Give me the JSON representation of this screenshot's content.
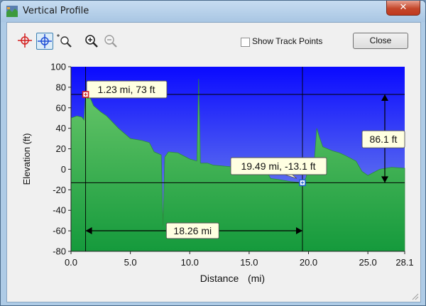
{
  "window": {
    "title": "Vertical Profile",
    "close_glyph": "✕",
    "icon": "app-profile-icon"
  },
  "toolbar": {
    "tools": [
      {
        "icon": "red-crosshair-icon",
        "color": "#d42020"
      },
      {
        "icon": "blue-crosshair-icon",
        "color": "#1f4fd6",
        "active": true
      },
      {
        "icon": "zoom-extent-icon"
      },
      {
        "icon": "zoom-in-icon"
      },
      {
        "icon": "zoom-out-icon",
        "disabled": true
      }
    ],
    "show_track_points_label": "Show Track Points",
    "show_track_points_checked": false,
    "close_label": "Close"
  },
  "colors": {
    "sky_top": "#0a0aff",
    "sky_bottom": "#8aa6e6",
    "terrain_top": "#6cc86c",
    "terrain_bottom": "#159a3c",
    "marker_red": "#d42020",
    "marker_blue": "#2060d0",
    "callout_fill": "#ffffe1"
  },
  "chart_data": {
    "type": "area",
    "xlabel": "Distance",
    "xunit": "(mi)",
    "ylabel": "Elevation (ft)",
    "xlim": [
      0,
      28.1
    ],
    "ylim": [
      -80,
      100
    ],
    "x_ticks": [
      "0.0",
      "5.0",
      "10.0",
      "15.0",
      "20.0",
      "25.0",
      "28.1"
    ],
    "x_tick_values": [
      0,
      5,
      10,
      15,
      20,
      25,
      28.1
    ],
    "y_ticks": [
      "100",
      "80",
      "60",
      "40",
      "20",
      "0",
      "-20",
      "-40",
      "-60",
      "-80"
    ],
    "y_tick_values": [
      100,
      80,
      60,
      40,
      20,
      0,
      -20,
      -40,
      -60,
      -80
    ],
    "profile": [
      [
        0.0,
        50
      ],
      [
        0.5,
        52
      ],
      [
        0.9,
        51
      ],
      [
        1.1,
        48
      ],
      [
        1.23,
        73
      ],
      [
        1.4,
        69
      ],
      [
        1.6,
        70
      ],
      [
        1.9,
        62
      ],
      [
        2.5,
        56
      ],
      [
        3.0,
        52
      ],
      [
        4.0,
        40
      ],
      [
        5.0,
        30
      ],
      [
        6.0,
        28
      ],
      [
        6.6,
        26
      ],
      [
        7.0,
        17
      ],
      [
        7.6,
        14
      ],
      [
        7.75,
        -55
      ],
      [
        7.9,
        12
      ],
      [
        8.2,
        17
      ],
      [
        9.0,
        16
      ],
      [
        10.0,
        10
      ],
      [
        10.6,
        8
      ],
      [
        10.75,
        88
      ],
      [
        10.9,
        6
      ],
      [
        11.5,
        6
      ],
      [
        12.0,
        4
      ],
      [
        13.0,
        3
      ],
      [
        14.0,
        2
      ],
      [
        15.0,
        0
      ],
      [
        16.0,
        -1
      ],
      [
        16.5,
        -2
      ],
      [
        16.8,
        -9
      ],
      [
        17.5,
        -10
      ],
      [
        18.5,
        -12
      ],
      [
        19.49,
        -13.1
      ],
      [
        19.8,
        -8
      ],
      [
        20.0,
        4
      ],
      [
        20.5,
        10
      ],
      [
        20.7,
        40
      ],
      [
        20.9,
        32
      ],
      [
        21.2,
        22
      ],
      [
        22.0,
        18
      ],
      [
        22.6,
        16
      ],
      [
        23.0,
        14
      ],
      [
        24.0,
        8
      ],
      [
        24.5,
        -2
      ],
      [
        25.0,
        -6
      ],
      [
        26.0,
        0
      ],
      [
        27.0,
        2
      ],
      [
        28.1,
        1
      ]
    ],
    "markers": [
      {
        "label": "1.23 mi, 73 ft",
        "x": 1.23,
        "y": 73,
        "color": "red"
      },
      {
        "label": "19.49 mi, -13.1 ft",
        "x": 19.49,
        "y": -13.1,
        "color": "blue"
      }
    ],
    "distance_measure": {
      "label": "18.26 mi",
      "from": 1.23,
      "to": 19.49
    },
    "elevation_measure": {
      "label": "86.1 ft",
      "from": -13.1,
      "to": 73
    }
  }
}
